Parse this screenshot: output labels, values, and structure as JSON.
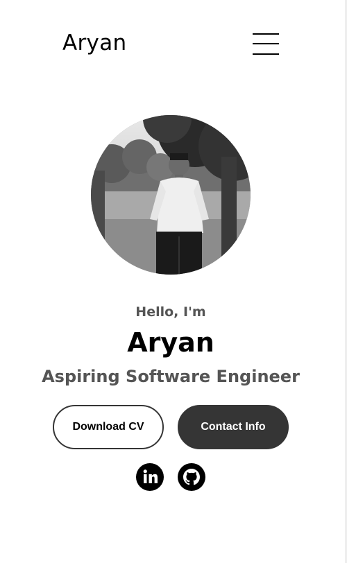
{
  "header": {
    "logo": "Aryan"
  },
  "profile": {
    "alt": "Aryan profile photo"
  },
  "hero": {
    "greeting": "Hello, I'm",
    "name": "Aryan",
    "title": "Aspiring Software Engineer"
  },
  "buttons": {
    "download_cv": "Download CV",
    "contact_info": "Contact Info"
  },
  "social": {
    "linkedin_icon": "linkedin-icon",
    "github_icon": "github-icon"
  }
}
